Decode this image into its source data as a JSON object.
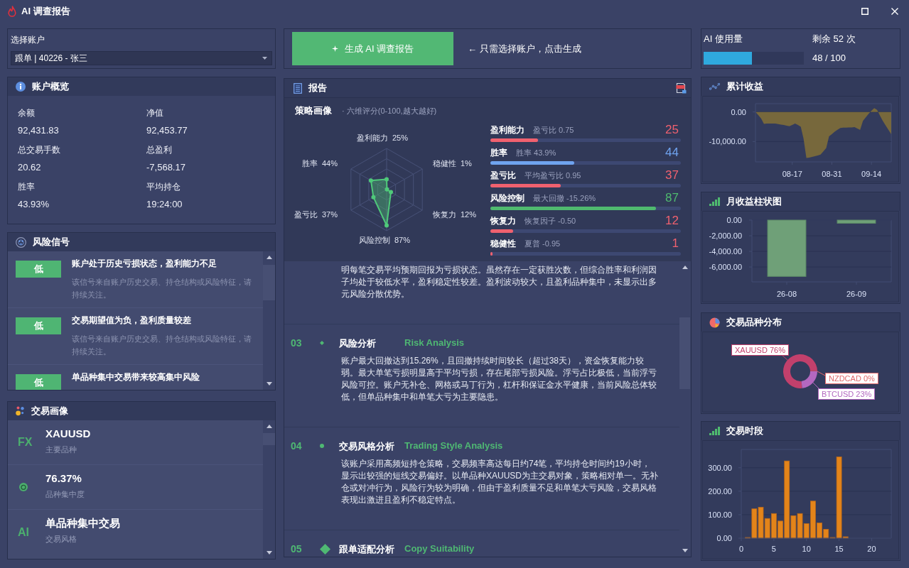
{
  "window": {
    "title": "AI 调查报告"
  },
  "account_select": {
    "label": "选择账户",
    "value": "跟单 | 40226 - 张三"
  },
  "overview": {
    "title": "账户概览",
    "fields": [
      {
        "label": "余额",
        "value": "92,431.83"
      },
      {
        "label": "净值",
        "value": "92,453.77"
      },
      {
        "label": "总交易手数",
        "value": "20.62"
      },
      {
        "label": "总盈利",
        "value": "-7,568.17"
      },
      {
        "label": "胜率",
        "value": "43.93%"
      },
      {
        "label": "平均持仓",
        "value": "19:24:00"
      }
    ]
  },
  "risk_signals": {
    "title": "风险信号",
    "items": [
      {
        "badge": "低",
        "title": "账户处于历史亏损状态，盈利能力不足",
        "description": "该信号来自账户历史交易、持仓结构或风险特征，请持续关注。"
      },
      {
        "badge": "低",
        "title": "交易期望值为负，盈利质量较差",
        "description": "该信号来自账户历史交易、持仓结构或风险特征，请持续关注。"
      },
      {
        "badge": "低",
        "title": "单品种集中交易带来较高集中风险"
      }
    ]
  },
  "trading_profile": {
    "title": "交易画像",
    "items": [
      {
        "kind": "text",
        "mark": "FX",
        "value": "XAUUSD",
        "label": "主要品种"
      },
      {
        "kind": "icon",
        "value": "76.37%",
        "label": "品种集中度"
      },
      {
        "kind": "text",
        "mark": "AI",
        "value": "单品种集中交易",
        "label": "交易风格"
      }
    ]
  },
  "generate": {
    "button": "生成 AI 调查报告",
    "hint": "← 只需选择账户，点击生成"
  },
  "report": {
    "title": "报告",
    "portrait": {
      "title": "策略画像",
      "subtitle": "· 六维评分(0-100,越大越好)",
      "radar_labels": [
        {
          "name": "盈利能力",
          "value": "25%"
        },
        {
          "name": "胜率",
          "value": "44%"
        },
        {
          "name": "盈亏比",
          "value": "37%"
        },
        {
          "name": "风险控制",
          "value": "87%"
        },
        {
          "name": "恢复力",
          "value": "12%"
        },
        {
          "name": "稳健性",
          "value": "1%"
        }
      ],
      "metrics": [
        {
          "name": "盈利能力",
          "detail": "盈亏比 0.75",
          "score": "25",
          "level": 0.25,
          "color": "#f0616f"
        },
        {
          "name": "胜率",
          "detail": "胜率 43.9%",
          "score": "44",
          "level": 0.44,
          "color": "#6fa3ef"
        },
        {
          "name": "盈亏比",
          "detail": "平均盈亏比 0.95",
          "score": "37",
          "level": 0.37,
          "color": "#f0616f"
        },
        {
          "name": "风险控制",
          "detail": "最大回撤 -15.26%",
          "score": "87",
          "level": 0.87,
          "color": "#4fba6f"
        },
        {
          "name": "恢复力",
          "detail": "恢复因子 -0.50",
          "score": "12",
          "level": 0.12,
          "color": "#f0616f"
        },
        {
          "name": "稳健性",
          "detail": "夏普 -0.95",
          "score": "1",
          "level": 0.01,
          "color": "#f0616f"
        }
      ]
    },
    "sections": [
      {
        "text": "明每笔交易平均预期回报为亏损状态。虽然存在一定获胜次数，但综合胜率和利润因子均处于较低水平，盈利稳定性较差。盈利波动较大，且盈利品种集中，未显示出多元风险分散优势。"
      },
      {
        "number": "03",
        "kind": "rhombus",
        "title": "风险分析",
        "subtitle": "Risk Analysis",
        "text": "账户最大回撤达到15.26%，且回撤持续时间较长（超过38天），资金恢复能力较弱。最大单笔亏损明显高于平均亏损，存在尾部亏损风险。浮亏占比极低，当前浮亏风险可控。账户无补仓、网格或马丁行为，杠杆和保证金水平健康，当前风险总体较低，但单品种集中和单笔大亏为主要隐患。"
      },
      {
        "number": "04",
        "kind": "dot",
        "title": "交易风格分析",
        "subtitle": "Trading Style Analysis",
        "text": "该账户采用高频短持仓策略，交易频率高达每日约74笔，平均持仓时间约19小时，显示出较强的短线交易偏好。以单品种XAUUSD为主交易对象，策略相对单一。无补仓或对冲行为，风险行为较为明确，但由于盈利质量不足和单笔大亏风险，交易风格表现出激进且盈利不稳定特点。"
      },
      {
        "number": "05",
        "kind": "diamond",
        "title": "跟单适配分析",
        "subtitle": "Copy Suitability"
      }
    ]
  },
  "usage": {
    "label": "AI 使用量",
    "remaining": "剩余 52 次",
    "level": 0.48,
    "reading": "48 / 100"
  },
  "cumulative_returns": {
    "title": "累计收益",
    "chart_data": {
      "type": "area",
      "categories": [
        null,
        null,
        null,
        null,
        null,
        null,
        null,
        null,
        null,
        null,
        null,
        null,
        null,
        "08-17",
        null,
        null,
        null,
        null,
        null,
        null,
        null,
        null,
        null,
        null,
        null,
        null,
        null,
        "08-31",
        null,
        null,
        null,
        null,
        null,
        null,
        null,
        null,
        null,
        null,
        null,
        null,
        null,
        "09-14",
        null,
        null,
        null,
        null,
        null,
        null,
        null
      ],
      "values": [
        0,
        -1100,
        -2200,
        -4000,
        -3900,
        -3900,
        -3900,
        -3900,
        -4100,
        -4300,
        -4400,
        -4600,
        -4800,
        -4400,
        -3900,
        -4400,
        -5000,
        -9000,
        -15500,
        -15400,
        -15200,
        -14900,
        -14700,
        -14400,
        -13300,
        -12200,
        -8200,
        -7500,
        -6700,
        -6000,
        -5400,
        -5300,
        -5300,
        -5200,
        -5200,
        -5100,
        -5600,
        -6100,
        -3000,
        -1800,
        -600,
        400,
        1300,
        700,
        -1200,
        -3000,
        -4500,
        -6000,
        -7500
      ],
      "ylim": [
        -16850,
        2800
      ],
      "yticks": [
        {
          "value": 0,
          "label": "0.00"
        },
        {
          "value": -10000,
          "label": "-10,000.00"
        }
      ],
      "grid": true
    }
  },
  "monthly_returns": {
    "title": "月收益柱状图",
    "chart_data": {
      "type": "bar",
      "categories": [
        "26-08",
        "26-09"
      ],
      "values": [
        -7200,
        -400
      ],
      "ylim": [
        -7900,
        0
      ],
      "yticks": [
        {
          "value": 0,
          "label": "0.00"
        },
        {
          "value": -2000,
          "label": "-2,000.00"
        },
        {
          "value": -4000,
          "label": "-4,000.00"
        },
        {
          "value": -6000,
          "label": "-6,000.00"
        }
      ],
      "grid": true
    }
  },
  "symbol_distribution": {
    "title": "交易品种分布",
    "chart_data": {
      "type": "donut",
      "categories": [
        "XAUUSD",
        "NZDCAD",
        "BTCUSD"
      ],
      "values": [
        76.37,
        0.4,
        23.23
      ],
      "colors": [
        "#c2406c",
        "#e0686a",
        "#b368c0"
      ],
      "value_labels": [
        "76%",
        "0%",
        "23%"
      ]
    }
  },
  "trading_hours": {
    "title": "交易时段",
    "chart_data": {
      "type": "bar",
      "x": [
        1,
        2,
        3,
        4,
        5,
        6,
        7,
        8,
        9,
        10,
        11,
        12,
        13,
        14,
        15,
        16
      ],
      "values": [
        3,
        125,
        132,
        84,
        105,
        73,
        329,
        96,
        105,
        62,
        158,
        65,
        38,
        3,
        346,
        6
      ],
      "xlim": [
        0,
        23
      ],
      "ylim": [
        0,
        378
      ],
      "xticks": [
        0,
        5,
        10,
        15,
        20
      ],
      "yticks": [
        {
          "value": 0,
          "label": "0.00"
        },
        {
          "value": 100,
          "label": "100.00"
        },
        {
          "value": 200,
          "label": "200.00"
        },
        {
          "value": 300,
          "label": "300.00"
        }
      ],
      "grid": true
    }
  }
}
